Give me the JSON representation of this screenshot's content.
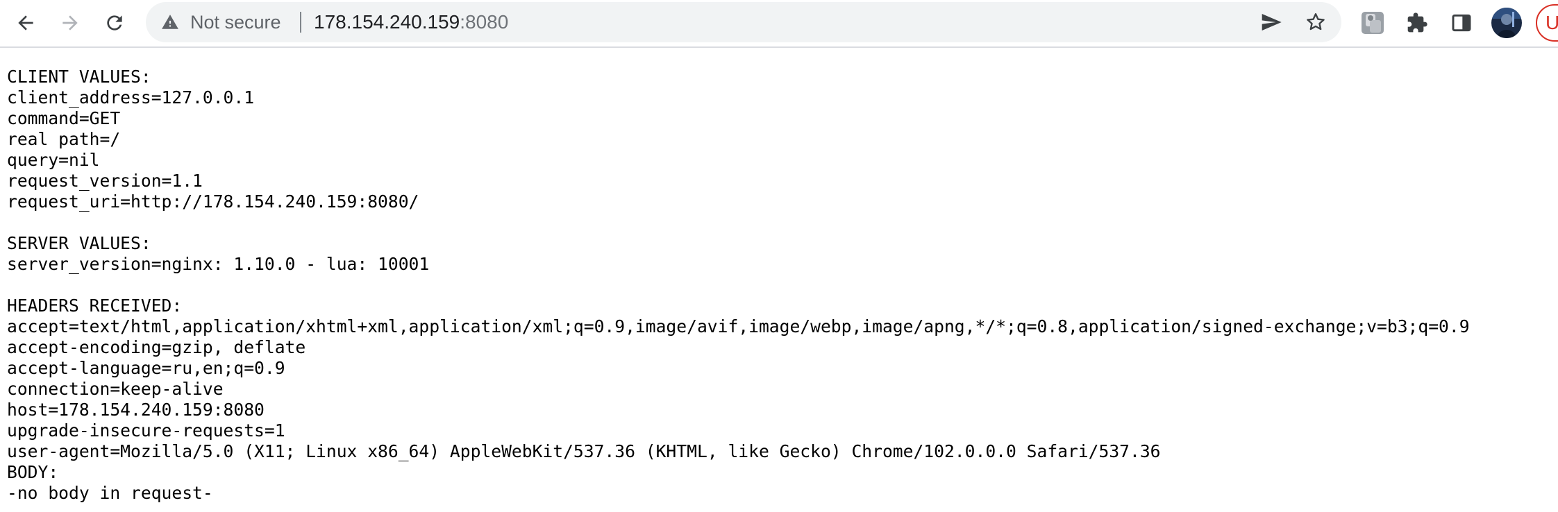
{
  "browser": {
    "security_label": "Not secure",
    "url_host": "178.154.240.159",
    "url_port": ":8080",
    "update_label": "U",
    "icons": {
      "back": "arrow-left-icon",
      "forward": "arrow-right-icon",
      "reload": "reload-icon",
      "security": "warning-triangle-icon",
      "send": "send-icon",
      "bookmark": "star-icon",
      "extension_app": "grey-extension-icon",
      "extensions": "puzzle-icon",
      "side_panel": "side-panel-icon",
      "profile": "avatar"
    }
  },
  "page": {
    "lines": [
      "CLIENT VALUES:",
      "client_address=127.0.0.1",
      "command=GET",
      "real path=/",
      "query=nil",
      "request_version=1.1",
      "request_uri=http://178.154.240.159:8080/",
      "",
      "SERVER VALUES:",
      "server_version=nginx: 1.10.0 - lua: 10001",
      "",
      "HEADERS RECEIVED:",
      "accept=text/html,application/xhtml+xml,application/xml;q=0.9,image/avif,image/webp,image/apng,*/*;q=0.8,application/signed-exchange;v=b3;q=0.9",
      "accept-encoding=gzip, deflate",
      "accept-language=ru,en;q=0.9",
      "connection=keep-alive",
      "host=178.154.240.159:8080",
      "upgrade-insecure-requests=1",
      "user-agent=Mozilla/5.0 (X11; Linux x86_64) AppleWebKit/537.36 (KHTML, like Gecko) Chrome/102.0.0.0 Safari/537.36",
      "BODY:",
      "-no body in request-"
    ]
  }
}
